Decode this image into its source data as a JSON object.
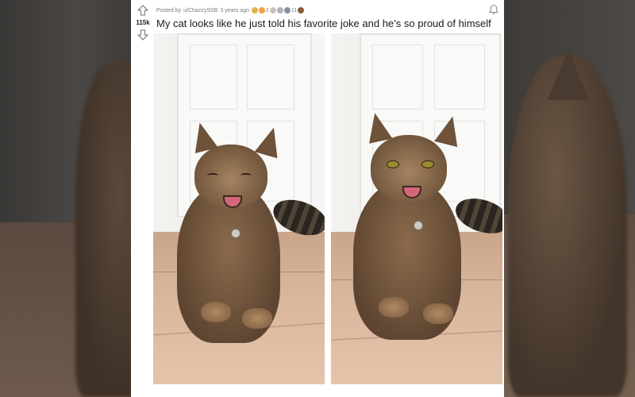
{
  "post": {
    "score": "115k",
    "meta": {
      "prefix": "Posted by",
      "author": "u/ChazzySSB",
      "age": "3 years ago",
      "award_count_1": "2",
      "award_count_2": "11"
    },
    "title": "My cat looks like he just told his favorite joke and he’s so proud of himself"
  },
  "icons": {
    "upvote": "arrow-up-icon",
    "downvote": "arrow-down-icon",
    "notify": "bell-icon"
  }
}
